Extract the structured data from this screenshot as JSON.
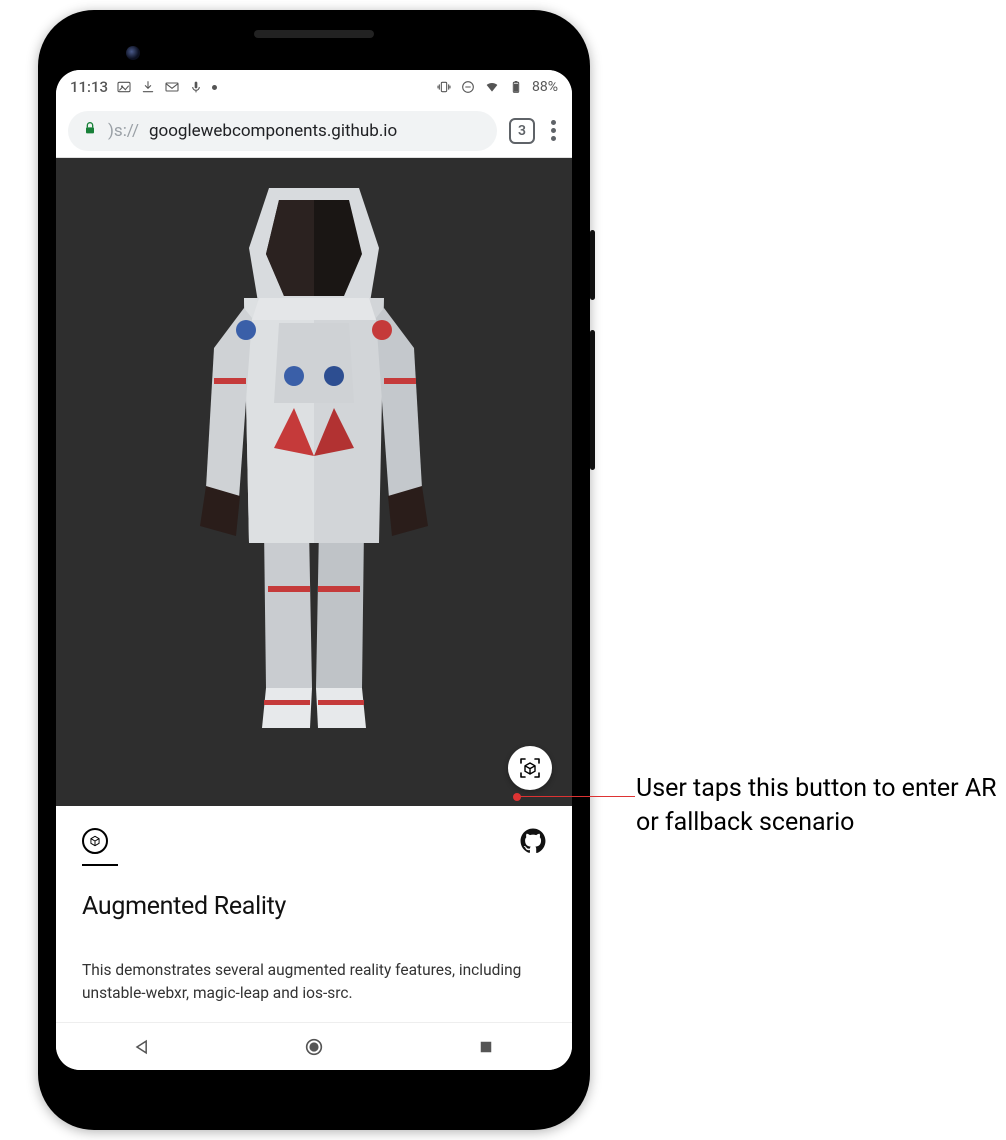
{
  "statusbar": {
    "time": "11:13",
    "battery_pct": "88%",
    "icons_left": [
      "image-icon",
      "download-icon",
      "gmail-icon",
      "mic-icon",
      "dot-icon"
    ],
    "icons_right": [
      "vibrate-icon",
      "dnd-icon",
      "wifi-icon",
      "battery-icon"
    ]
  },
  "browser": {
    "url_display": "googlewebcomponents.github.io",
    "url_prefix": ")s://",
    "tab_count": "3"
  },
  "page": {
    "title": "Augmented Reality",
    "body": "This demonstrates several augmented reality features, including unstable-webxr, magic-leap and ios-src.",
    "model_name": "astronaut"
  },
  "annotation": {
    "text": "User taps this button to enter AR or fallback scenario"
  }
}
